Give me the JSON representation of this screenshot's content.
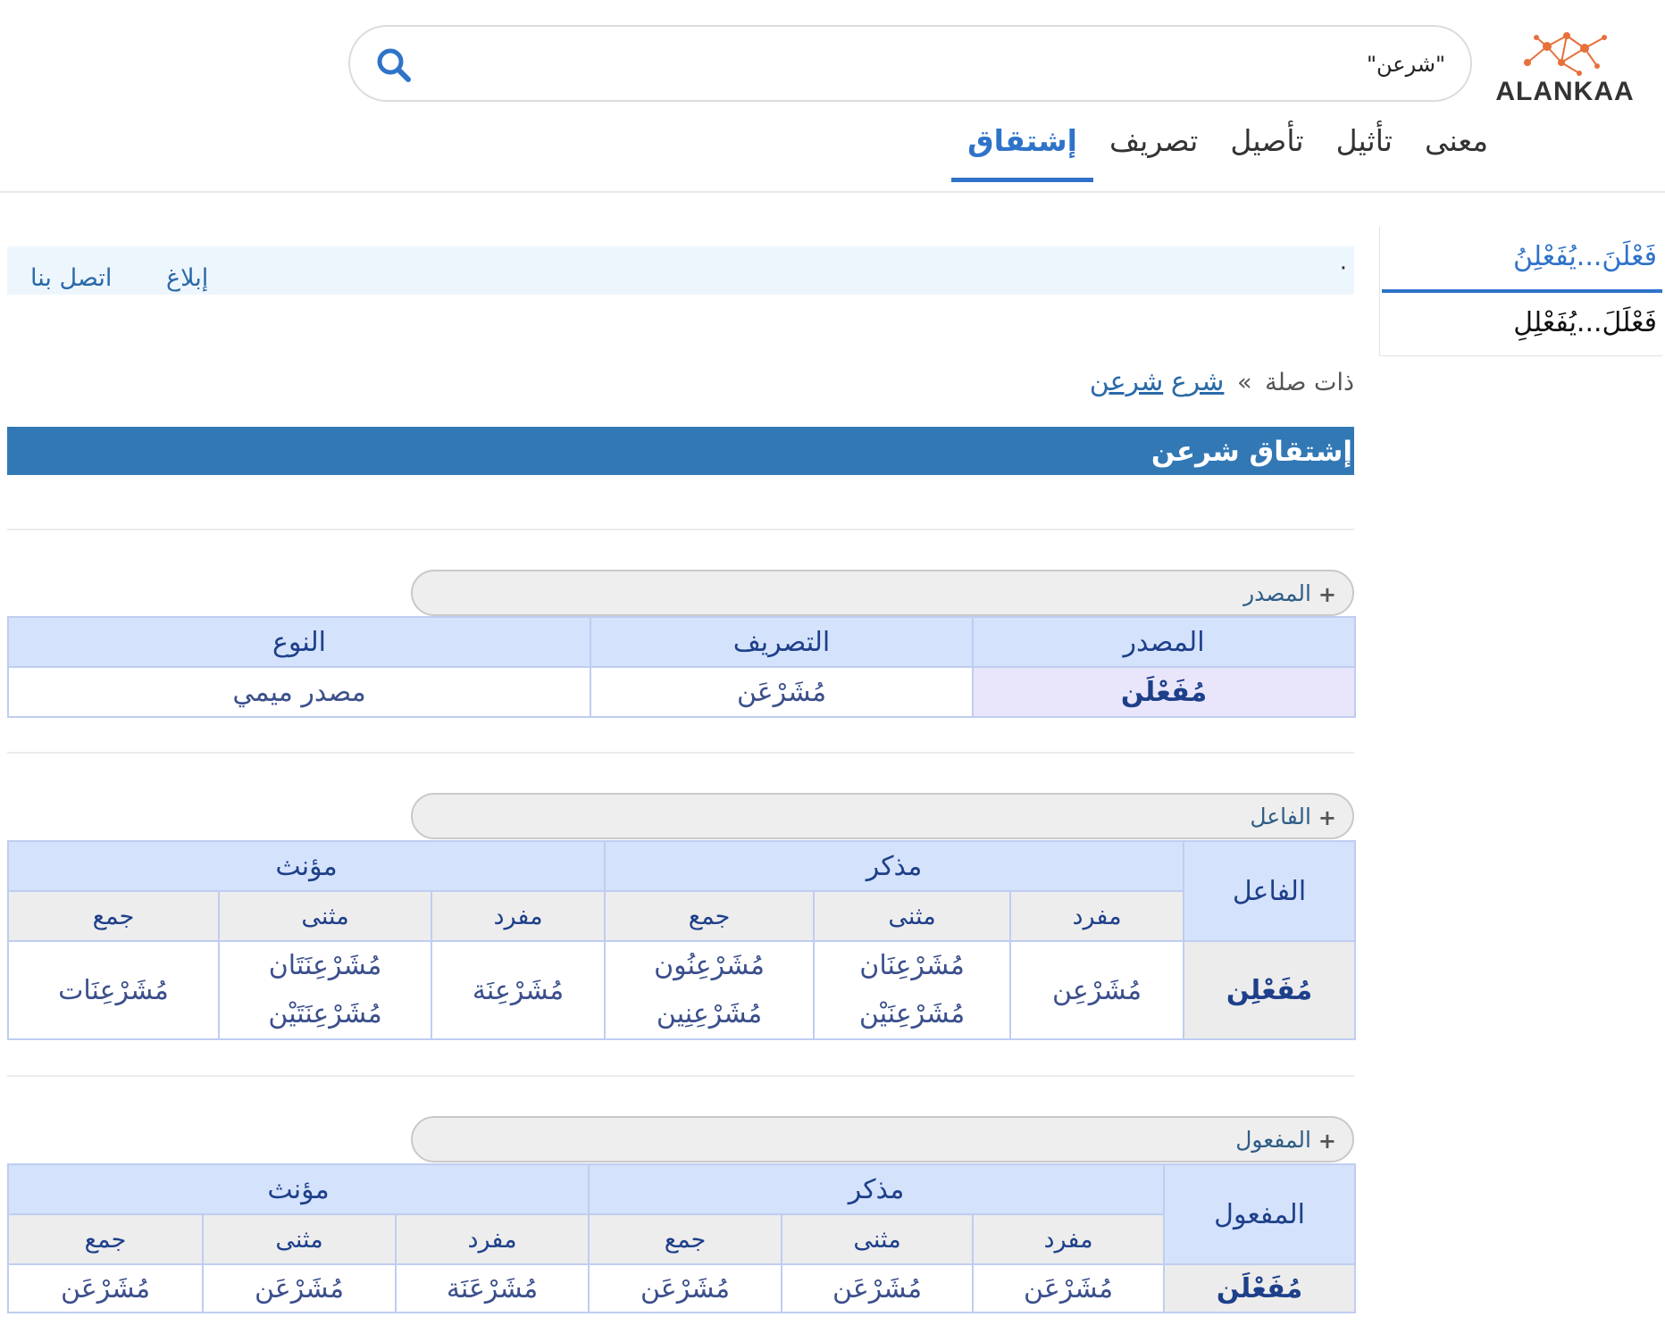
{
  "brand": {
    "name": "ALANKAA"
  },
  "search": {
    "value": "\"شرعن\"",
    "icon": "search-icon"
  },
  "tabs": [
    {
      "label": "معنى"
    },
    {
      "label": "تأثيل"
    },
    {
      "label": "تأصيل"
    },
    {
      "label": "تصريف"
    },
    {
      "label": "إشتقاق",
      "active": true
    }
  ],
  "sidebar": {
    "items": [
      "فَعْلَنَ...يُفَعْلِنُ",
      "فَعْلَلَ...يُفَعْلِلِ"
    ]
  },
  "report": {
    "dot": "·",
    "report_label": "إبلاغ",
    "contact_label": "اتصل بنا"
  },
  "breadcrumb": {
    "prefix": "ذات صلة",
    "sep": "»",
    "link1": "شرع",
    "link2": "شرعن"
  },
  "section": {
    "title": "إشتقاق شرعن"
  },
  "masdar": {
    "toggle": "المصدر",
    "headers": [
      "المصدر",
      "التصريف",
      "النوع"
    ],
    "row": [
      "مُفَعْلَن",
      "مُشَرْعَن",
      "مصدر ميمي"
    ]
  },
  "fail": {
    "toggle": "الفاعل",
    "corner": "الفاعل",
    "groups": [
      "مذكر",
      "مؤنث"
    ],
    "subs": [
      "مفرد",
      "مثنى",
      "جمع",
      "مفرد",
      "مثنى",
      "جمع"
    ],
    "pattern": "مُفَعْلِن",
    "cells": {
      "m_sing": "مُشَرْعِن",
      "m_dual_1": "مُشَرْعِنَان",
      "m_dual_2": "مُشَرْعِنَيْن",
      "m_pl_1": "مُشَرْعِنُون",
      "m_pl_2": "مُشَرْعِنِين",
      "f_sing": "مُشَرْعِنَة",
      "f_dual_1": "مُشَرْعِنَتَان",
      "f_dual_2": "مُشَرْعِنَتَيْن",
      "f_pl": "مُشَرْعِنَات"
    }
  },
  "mafool": {
    "toggle": "المفعول",
    "corner": "المفعول",
    "groups": [
      "مذكر",
      "مؤنث"
    ],
    "subs": [
      "مفرد",
      "مثنى",
      "جمع",
      "مفرد",
      "مثنى",
      "جمع"
    ],
    "pattern": "مُفَعْلَن",
    "cells": [
      "مُشَرْعَن",
      "مُشَرْعَن",
      "مُشَرْعَن",
      "مُشَرْعَنَة",
      "مُشَرْعَن",
      "مُشَرْعَن"
    ]
  },
  "colors": {
    "accent": "#2f73c9",
    "section_bg": "#3278b5",
    "table_header": "#d4e3fb",
    "table_border": "#bfcdf0"
  }
}
